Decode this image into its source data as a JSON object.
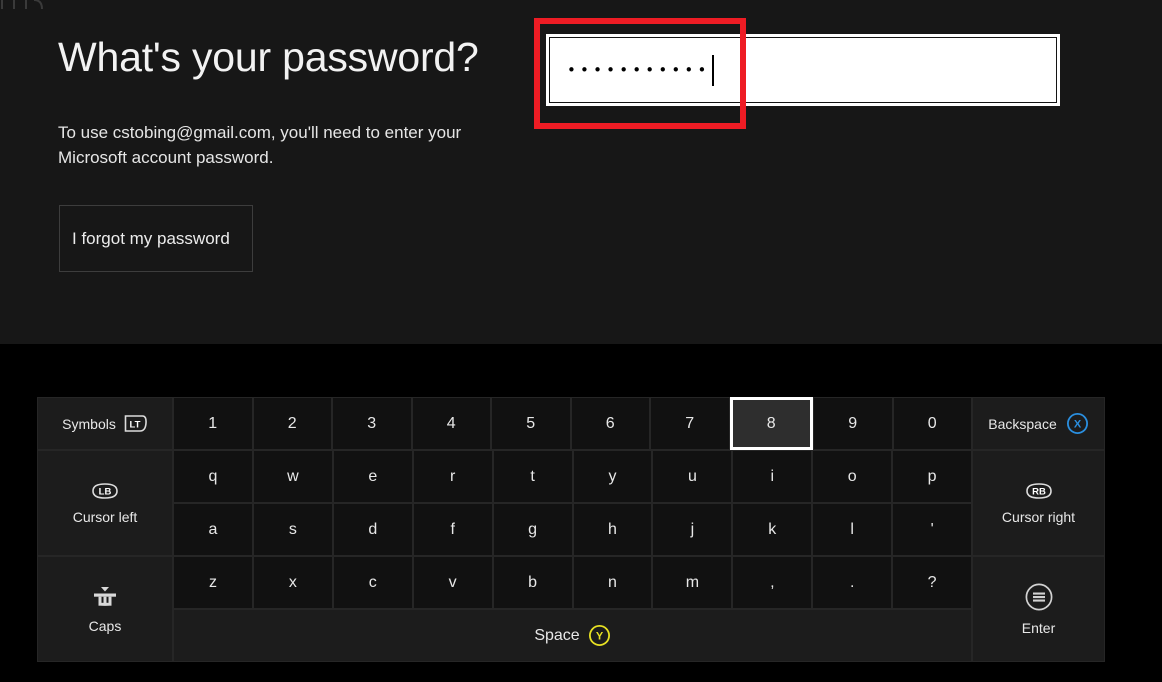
{
  "screen": {
    "background": "#000000",
    "panel_background": "#171717",
    "accent_blue": "#2a8fe0",
    "accent_yellow": "#e8e123",
    "annotation_color": "#ee1c24"
  },
  "prompt": {
    "heading": "What's your password?",
    "subtext": "To use cstobing@gmail.com, you'll need to enter your Microsoft account password.",
    "email": "cstobing@gmail.com",
    "forgot_button_label": "I forgot my password"
  },
  "password_field": {
    "masked_value": "•••••••••••",
    "character_count": 11,
    "focused": true,
    "caret_visible": true,
    "annotated": true
  },
  "keyboard": {
    "left_keys": [
      {
        "name": "symbols",
        "label": "Symbols",
        "badge": "LT",
        "badge_type": "trigger"
      },
      {
        "name": "cursor-left",
        "label": "Cursor left",
        "badge": "LB",
        "badge_type": "bumper"
      },
      {
        "name": "caps",
        "label": "Caps",
        "badge": "",
        "badge_type": "caps-icon"
      }
    ],
    "rows": [
      {
        "name": "number-row",
        "keys": [
          "1",
          "2",
          "3",
          "4",
          "5",
          "6",
          "7",
          "8",
          "9",
          "0"
        ]
      },
      {
        "name": "qwerty-row",
        "keys": [
          "q",
          "w",
          "e",
          "r",
          "t",
          "y",
          "u",
          "i",
          "o",
          "p"
        ]
      },
      {
        "name": "home-row",
        "keys": [
          "a",
          "s",
          "d",
          "f",
          "g",
          "h",
          "j",
          "k",
          "l",
          "'"
        ]
      },
      {
        "name": "bottom-row",
        "keys": [
          "z",
          "x",
          "c",
          "v",
          "b",
          "n",
          "m",
          ",",
          ".",
          "?"
        ]
      }
    ],
    "focused_key": "8",
    "space": {
      "label": "Space",
      "badge": "Y",
      "badge_type": "face-button",
      "badge_color": "#e8e123"
    },
    "right_keys": [
      {
        "name": "backspace",
        "label": "Backspace",
        "badge": "X",
        "badge_type": "face-button",
        "badge_color": "#2a8fe0"
      },
      {
        "name": "cursor-right",
        "label": "Cursor right",
        "badge": "RB",
        "badge_type": "bumper"
      },
      {
        "name": "enter",
        "label": "Enter",
        "badge": "",
        "badge_type": "menu-icon"
      }
    ]
  }
}
